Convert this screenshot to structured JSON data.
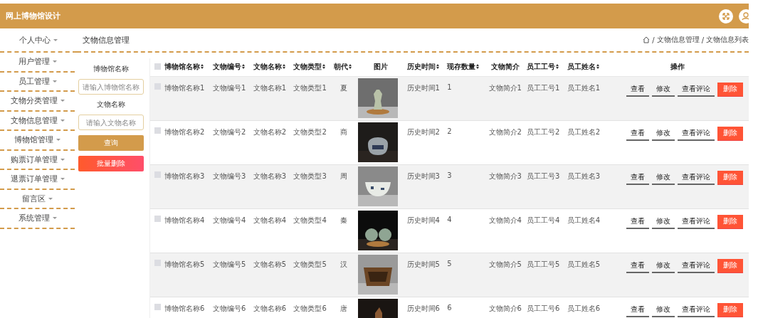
{
  "header": {
    "title": "网上博物馆设计"
  },
  "sidebar": {
    "items": [
      {
        "label": "个人中心"
      },
      {
        "label": "用户管理"
      },
      {
        "label": "员工管理"
      },
      {
        "label": "文物分类管理"
      },
      {
        "label": "文物信息管理"
      },
      {
        "label": "博物馆管理"
      },
      {
        "label": "购票订单管理"
      },
      {
        "label": "退票订单管理"
      },
      {
        "label": "留言区"
      },
      {
        "label": "系统管理"
      }
    ]
  },
  "page_title": "文物信息管理",
  "breadcrumb": {
    "separator": "/",
    "items": [
      "文物信息管理",
      "文物信息列表"
    ]
  },
  "search": {
    "fields": [
      {
        "label": "博物馆名称",
        "placeholder": "请输入博物馆名称"
      },
      {
        "label": "文物名称",
        "placeholder": "请输入文物名称"
      }
    ],
    "buttons": [
      {
        "label": "查询",
        "kind": "primary"
      },
      {
        "label": "批量删除",
        "kind": "danger"
      }
    ]
  },
  "table": {
    "select_all": {
      "checked": false
    },
    "columns": [
      {
        "label": "博物馆名称",
        "sortable": true
      },
      {
        "label": "文物编号",
        "sortable": true
      },
      {
        "label": "文物名称",
        "sortable": true
      },
      {
        "label": "文物类型",
        "sortable": true
      },
      {
        "label": "朝代",
        "sortable": true
      },
      {
        "label": "图片",
        "sortable": false
      },
      {
        "label": "历史时间",
        "sortable": true
      },
      {
        "label": "现存数量",
        "sortable": true
      },
      {
        "label": "文物简介",
        "sortable": false
      },
      {
        "label": "员工工号",
        "sortable": true
      },
      {
        "label": "员工姓名",
        "sortable": true
      },
      {
        "label": "操作",
        "sortable": false
      }
    ],
    "rows": [
      {
        "checked": false,
        "cells": [
          "博物馆名称1",
          "文物编号1",
          "文物名称1",
          "文物类型1",
          "夏",
          {
            "kind": "picture"
          },
          "历史时间1",
          "1",
          "文物简介1",
          "员工工号1",
          "员工姓名1"
        ],
        "actions": [
          {
            "label": "查看",
            "kind": "link"
          },
          {
            "label": "修改",
            "kind": "link"
          },
          {
            "label": "查看评论",
            "kind": "link"
          },
          {
            "label": "删除",
            "kind": "danger"
          }
        ]
      },
      {
        "checked": false,
        "cells": [
          "博物馆名称2",
          "文物编号2",
          "文物名称2",
          "文物类型2",
          "商",
          {
            "kind": "picture"
          },
          "历史时间2",
          "2",
          "文物简介2",
          "员工工号2",
          "员工姓名2"
        ],
        "actions": [
          {
            "label": "查看",
            "kind": "link"
          },
          {
            "label": "修改",
            "kind": "link"
          },
          {
            "label": "查看评论",
            "kind": "link"
          },
          {
            "label": "删除",
            "kind": "danger"
          }
        ]
      },
      {
        "checked": false,
        "cells": [
          "博物馆名称3",
          "文物编号3",
          "文物名称3",
          "文物类型3",
          "周",
          {
            "kind": "picture"
          },
          "历史时间3",
          "3",
          "文物简介3",
          "员工工号3",
          "员工姓名3"
        ],
        "actions": [
          {
            "label": "查看",
            "kind": "link"
          },
          {
            "label": "修改",
            "kind": "link"
          },
          {
            "label": "查看评论",
            "kind": "link"
          },
          {
            "label": "删除",
            "kind": "danger"
          }
        ]
      },
      {
        "checked": false,
        "cells": [
          "博物馆名称4",
          "文物编号4",
          "文物名称4",
          "文物类型4",
          "秦",
          {
            "kind": "picture"
          },
          "历史时间4",
          "4",
          "文物简介4",
          "员工工号4",
          "员工姓名4"
        ],
        "actions": [
          {
            "label": "查看",
            "kind": "link"
          },
          {
            "label": "修改",
            "kind": "link"
          },
          {
            "label": "查看评论",
            "kind": "link"
          },
          {
            "label": "删除",
            "kind": "danger"
          }
        ]
      },
      {
        "checked": false,
        "cells": [
          "博物馆名称5",
          "文物编号5",
          "文物名称5",
          "文物类型5",
          "汉",
          {
            "kind": "picture"
          },
          "历史时间5",
          "5",
          "文物简介5",
          "员工工号5",
          "员工姓名5"
        ],
        "actions": [
          {
            "label": "查看",
            "kind": "link"
          },
          {
            "label": "修改",
            "kind": "link"
          },
          {
            "label": "查看评论",
            "kind": "link"
          },
          {
            "label": "删除",
            "kind": "danger"
          }
        ]
      },
      {
        "checked": false,
        "cells": [
          "博物馆名称6",
          "文物编号6",
          "文物名称6",
          "文物类型6",
          "唐",
          {
            "kind": "picture"
          },
          "历史时间6",
          "6",
          "文物简介6",
          "员工工号6",
          "员工姓名6"
        ],
        "actions": [
          {
            "label": "查看",
            "kind": "link"
          },
          {
            "label": "修改",
            "kind": "link"
          },
          {
            "label": "查看评论",
            "kind": "link"
          },
          {
            "label": "删除",
            "kind": "danger"
          }
        ]
      }
    ]
  }
}
